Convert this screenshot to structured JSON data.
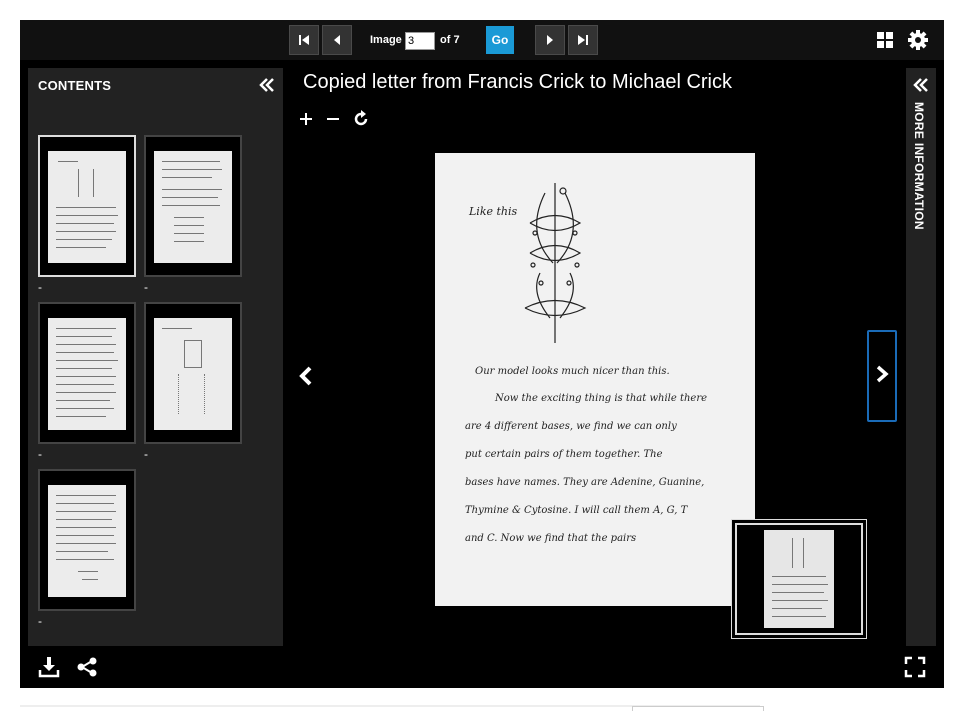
{
  "toolbar": {
    "image_label": "Image",
    "image_value": "3",
    "of_label": "of 7",
    "go_label": "Go",
    "icons": [
      "first-page-icon",
      "previous-page-icon",
      "next-page-icon",
      "last-page-icon",
      "grid-view-icon",
      "settings-icon"
    ],
    "accent_color": "#1a9ad6"
  },
  "sidebar": {
    "title": "CONTENTS",
    "thumbnails": [
      {
        "caption": "-",
        "active": true
      },
      {
        "caption": "-",
        "active": false
      },
      {
        "caption": "-",
        "active": false
      },
      {
        "caption": "-",
        "active": false
      },
      {
        "caption": "-",
        "active": false
      }
    ]
  },
  "viewer": {
    "title": "Copied letter from Francis Crick to Michael Crick",
    "controls": [
      "zoom-in-icon",
      "zoom-out-icon",
      "rotate-icon"
    ],
    "handwriting": [
      "Like this",
      "Our model looks much nicer than this.",
      "Now the exciting thing is that while there",
      "are 4 different bases, we find we can only",
      "put certain pairs of them together. The",
      "bases have names. They are Adenine, Guanine,",
      "Thymine & Cytosine. I will call them A, G, T",
      "and C. Now we find that the pairs"
    ]
  },
  "more_info": {
    "label": "MORE INFORMATION"
  },
  "footer": {
    "icons": [
      "download-icon",
      "share-icon",
      "fullscreen-icon"
    ]
  }
}
